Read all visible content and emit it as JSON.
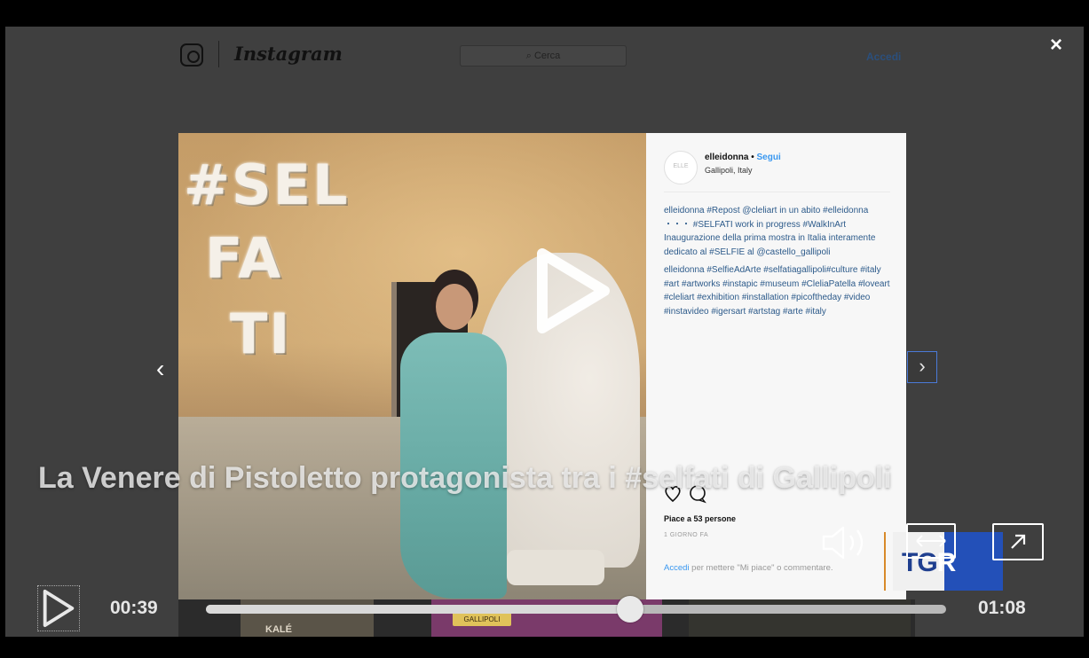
{
  "instagram": {
    "wordmark": "Instagram",
    "search_placeholder": "Cerca",
    "login_label": "Accedi"
  },
  "close_label": "×",
  "post": {
    "wall_text": [
      "#SEL",
      "FA",
      "TI"
    ],
    "username": "elleidonna",
    "separator": " • ",
    "follow_label": "Segui",
    "location": "Gallipoli, Italy",
    "caption_1": "elleidonna #Repost @cleliart in un abito #elleidonna ・・・ #SELFATI work in progress #WalkInArt Inaugurazione della prima mostra in Italia interamente dedicato al #SELFIE al @castello_gallipoli",
    "caption_2": "elleidonna #SelfieAdArte #selfatiagallipoli#culture #italy #art #artworks #instapic #museum #CleliaPatella #loveart #cleliart #exhibition #installation #picoftheday #video #instavideo #igersart #artstag #arte #italy",
    "likes": "Piace a 53 persone",
    "time_ago": "1 GIORNO FA",
    "login_link": "Accedi",
    "login_text": " per mettere \"Mi piace\" o commentare."
  },
  "headline": "La Venere di Pistoletto protagonista tra i #selfati di Gallipoli",
  "brand": {
    "logo_text_dark": "TG",
    "logo_text_light": "R",
    "accent_orange": "#d88a2a",
    "accent_blue": "#2350b8"
  },
  "player": {
    "current_time": "00:39",
    "duration": "01:08",
    "progress": 0.573,
    "icons": [
      "play-icon",
      "volume-icon",
      "resize-icon",
      "expand-icon",
      "chevron-left-icon",
      "chevron-right-icon",
      "heart-icon",
      "comment-icon",
      "close-icon"
    ]
  },
  "thumbnails": [
    "KALÉ",
    "CERCATE A GALLIPOLI"
  ]
}
